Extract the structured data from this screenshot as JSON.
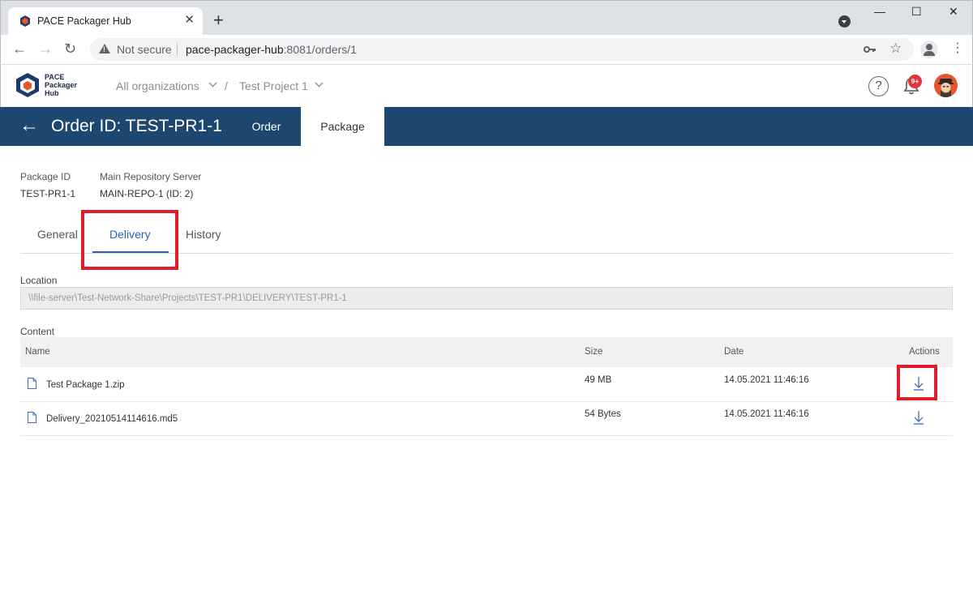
{
  "browser": {
    "tab_title": "PACE Packager Hub",
    "tab_close": "✕",
    "new_tab": "+",
    "security_label": "Not secure",
    "url_host": "pace-packager-hub",
    "url_path": ":8081/orders/1",
    "minimize": "—",
    "maximize": "☐",
    "close": "✕",
    "back": "←",
    "forward": "→",
    "reload": "↻",
    "menu": "⋮"
  },
  "header": {
    "logo_lines": [
      "PACE",
      "Packager",
      "Hub"
    ],
    "org_crumb": "All organizations",
    "crumb_separator": "/",
    "project_crumb": "Test Project 1",
    "notification_count": "9+",
    "help": "?"
  },
  "bluebar": {
    "back": "←",
    "title": "Order ID: TEST-PR1-1",
    "tabs": [
      "Order",
      "Package"
    ],
    "active_tab": "Package",
    "color": "#1e4770"
  },
  "package_info": {
    "package_id_label": "Package ID",
    "package_id_value": "TEST-PR1-1",
    "server_label": "Main Repository Server",
    "server_value": "MAIN-REPO-1 (ID: 2)"
  },
  "subtabs": {
    "items": [
      "General",
      "Delivery",
      "History"
    ],
    "active": "Delivery",
    "accent": "#2e62b0"
  },
  "location": {
    "label": "Location",
    "value": "\\\\file-server\\Test-Network-Share\\Projects\\TEST-PR1\\DELIVERY\\TEST-PR1-1"
  },
  "content": {
    "label": "Content",
    "columns": [
      "Name",
      "Size",
      "Date",
      "Actions"
    ],
    "rows": [
      {
        "name": "Test Package 1.zip",
        "size": "49 MB",
        "date": "14.05.2021 11:46:16",
        "action": "download-icon"
      },
      {
        "name": "Delivery_20210514114616.md5",
        "size": "54 Bytes",
        "date": "14.05.2021 11:46:16",
        "action": "download-icon"
      }
    ]
  },
  "highlight_color": "#e21d2b"
}
